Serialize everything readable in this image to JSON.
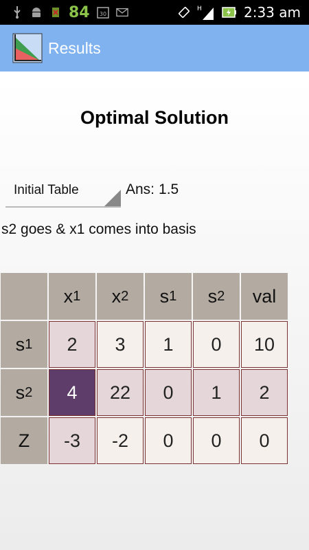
{
  "status_bar": {
    "battery_level": "84",
    "signal_label": "H",
    "time": "2:33 am",
    "colors": {
      "battery_text": "#8bc34a"
    }
  },
  "action_bar": {
    "title": "Results",
    "icon": "app-chart-icon",
    "color": "#7fb2ef"
  },
  "main": {
    "heading": "Optimal Solution",
    "spinner": {
      "selected": "Initial Table"
    },
    "answer_label": "Ans:",
    "answer_value": "1.5",
    "message": "s2 goes & x1 comes into basis"
  },
  "table": {
    "columns": [
      {
        "base": "x",
        "sub": "1"
      },
      {
        "base": "x",
        "sub": "2"
      },
      {
        "base": "s",
        "sub": "1"
      },
      {
        "base": "s",
        "sub": "2"
      },
      {
        "base": "val",
        "sub": ""
      }
    ],
    "rows": [
      {
        "base": "s",
        "sub": "1",
        "cells": [
          "2",
          "3",
          "1",
          "0",
          "10"
        ]
      },
      {
        "base": "s",
        "sub": "2",
        "cells": [
          "4",
          "22",
          "0",
          "1",
          "2"
        ]
      },
      {
        "base": "Z",
        "sub": "",
        "cells": [
          "-3",
          "-2",
          "0",
          "0",
          "0"
        ]
      }
    ],
    "pivot": {
      "row": 1,
      "col": 0
    },
    "colors": {
      "header": "#b3aaa2",
      "cell_light": "#f5f0eb",
      "cell_pink": "#e4d6d9",
      "pivot": "#5e3d6b",
      "border": "#7a3030"
    }
  }
}
